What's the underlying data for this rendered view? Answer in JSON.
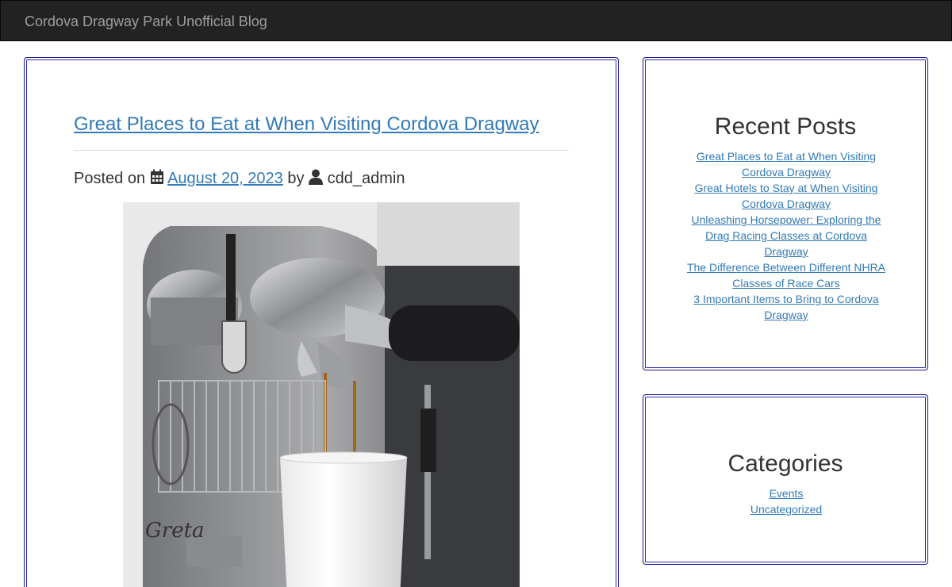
{
  "header": {
    "brand": "Cordova Dragway Park Unofficial Blog"
  },
  "post": {
    "title": "Great Places to Eat at When Visiting Cordova Dragway",
    "posted_on_label": "Posted on",
    "date": "August 20, 2023",
    "by_label": "by",
    "author": "cdd_admin",
    "image_text": "Greta"
  },
  "sidebar": {
    "recent_posts": {
      "title": "Recent Posts",
      "items": [
        "Great Places to Eat at When Visiting Cordova Dragway",
        "Great Hotels to Stay at When Visiting Cordova Dragway",
        "Unleashing Horsepower: Exploring the Drag Racing Classes at Cordova Dragway",
        "The Difference Between Different NHRA Classes of Race Cars",
        "3 Important Items to Bring to Cordova Dragway"
      ]
    },
    "categories": {
      "title": "Categories",
      "items": [
        "Events",
        "Uncategorized"
      ]
    }
  },
  "colors": {
    "navbar": "#222222",
    "link": "#337ab7",
    "card_border": "#2b2bb0"
  },
  "icons": {
    "date": "calendar-icon",
    "author": "user-icon"
  }
}
